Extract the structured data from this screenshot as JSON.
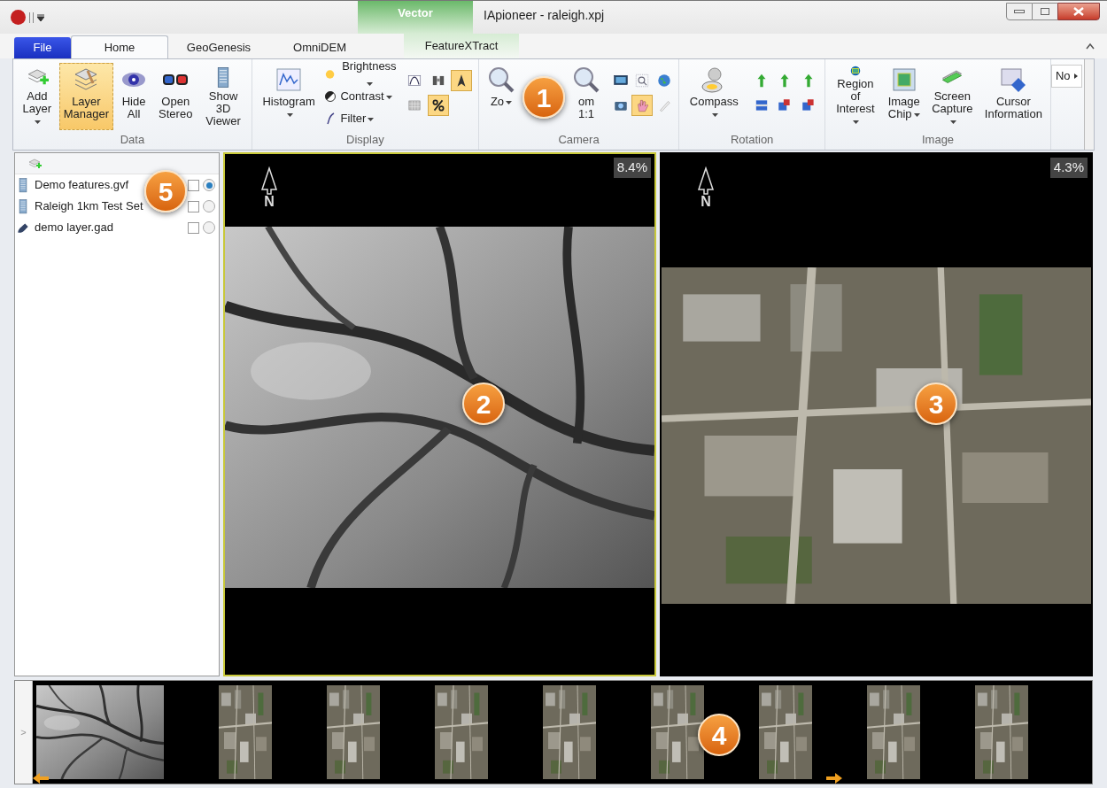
{
  "window": {
    "title": "IApioneer - raleigh.xpj",
    "context_group": "Vector"
  },
  "tabs": [
    {
      "label": "File",
      "kind": "file",
      "selected": false
    },
    {
      "label": "Home",
      "kind": "tab",
      "selected": true
    },
    {
      "label": "GeoGenesis",
      "kind": "tab",
      "selected": false
    },
    {
      "label": "OmniDEM",
      "kind": "tab",
      "selected": false
    },
    {
      "label": "FeatureXTract",
      "kind": "context",
      "selected": false
    }
  ],
  "ribbon": [
    {
      "name": "Data",
      "items": [
        {
          "kind": "large",
          "label": "Add\nLayer",
          "dropdown": true,
          "selected": false
        },
        {
          "kind": "large",
          "label": "Layer\nManager",
          "dropdown": false,
          "selected": true
        },
        {
          "kind": "large",
          "label": "Hide\nAll",
          "dropdown": false,
          "selected": false
        },
        {
          "kind": "large",
          "label": "Open\nStereo",
          "dropdown": false,
          "selected": false
        },
        {
          "kind": "large",
          "label": "Show 3D\nViewer",
          "dropdown": false,
          "selected": false
        }
      ]
    },
    {
      "name": "Display",
      "items": [
        {
          "kind": "large",
          "label": "Histogram",
          "dropdown": true,
          "selected": false
        },
        {
          "kind": "stack",
          "rows": [
            {
              "label": "Brightness",
              "dropdown": true
            },
            {
              "label": "Contrast",
              "dropdown": true
            },
            {
              "label": "Filter",
              "dropdown": true
            }
          ]
        },
        {
          "kind": "grid",
          "cells": [
            {
              "selected": false
            },
            {
              "selected": false
            },
            {
              "selected": true
            },
            {
              "selected": false
            },
            {
              "selected": true
            }
          ]
        }
      ]
    },
    {
      "name": "Camera",
      "items": [
        {
          "kind": "large",
          "label": "Zo",
          "dropdown": true,
          "selected": false
        },
        {
          "kind": "large",
          "label": "om\n1:1",
          "dropdown": false,
          "selected": false
        },
        {
          "kind": "grid",
          "cells": [
            {
              "selected": false
            },
            {
              "selected": false
            },
            {
              "selected": false
            },
            {
              "selected": false
            },
            {
              "selected": true
            },
            {
              "selected": false
            }
          ]
        }
      ]
    },
    {
      "name": "Rotation",
      "items": [
        {
          "kind": "large",
          "label": "Compass",
          "dropdown": true,
          "selected": false
        },
        {
          "kind": "grid",
          "cells": [
            {
              "selected": false
            },
            {
              "selected": false
            },
            {
              "selected": false
            },
            {
              "selected": false
            },
            {
              "selected": false
            },
            {
              "selected": false
            }
          ]
        }
      ]
    },
    {
      "name": "Image",
      "items": [
        {
          "kind": "large",
          "label": "Region of\nInterest",
          "dropdown": true,
          "selected": false
        },
        {
          "kind": "large",
          "label": "Image\nChip",
          "dropdown": true,
          "selected": false
        },
        {
          "kind": "large",
          "label": "Screen\nCapture",
          "dropdown": true,
          "selected": false
        },
        {
          "kind": "large",
          "label": "Cursor\nInformation",
          "dropdown": false,
          "selected": false
        }
      ]
    }
  ],
  "ribbon_overflow": "No",
  "layers": [
    {
      "name": "Demo features.gvf",
      "kind": "building",
      "checked": false,
      "selected": true
    },
    {
      "name": "Raleigh 1km Test Set",
      "kind": "building",
      "checked": false,
      "selected": false
    },
    {
      "name": "demo layer.gad",
      "kind": "brush",
      "checked": false,
      "selected": false
    }
  ],
  "views": [
    {
      "kind": "dem",
      "zoom": "8.4%",
      "north": "N",
      "selected": true
    },
    {
      "kind": "aerial",
      "zoom": "4.3%",
      "north": "N",
      "selected": false
    }
  ],
  "filmstrip": [
    {
      "kind": "dem"
    },
    {
      "kind": "aerial"
    },
    {
      "kind": "aerial"
    },
    {
      "kind": "aerial"
    },
    {
      "kind": "aerial"
    },
    {
      "kind": "aerial"
    },
    {
      "kind": "aerial"
    },
    {
      "kind": "aerial"
    },
    {
      "kind": "aerial"
    }
  ],
  "filmstrip_toggle": ">",
  "callouts": [
    {
      "label": "1"
    },
    {
      "label": "2"
    },
    {
      "label": "3"
    },
    {
      "label": "4"
    },
    {
      "label": "5"
    }
  ]
}
